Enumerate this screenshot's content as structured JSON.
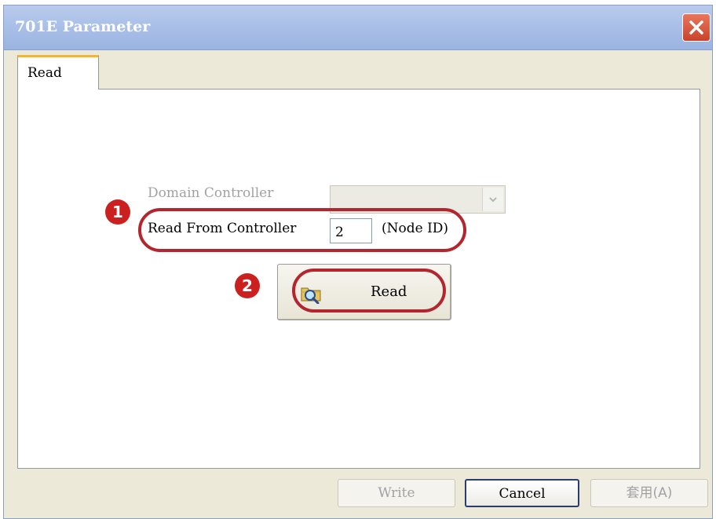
{
  "window": {
    "title": "701E Parameter"
  },
  "tabs": [
    {
      "label": "Read"
    }
  ],
  "form": {
    "domain_controller_label": "Domain Controller",
    "domain_controller_value": "",
    "read_from_label": "Read From Controller",
    "node_id_value": "2",
    "node_id_suffix": "(Node ID)",
    "read_button_label": "Read"
  },
  "annotations": {
    "step1": "1",
    "step2": "2"
  },
  "footer": {
    "write_label": "Write",
    "cancel_label": "Cancel",
    "apply_label": "套用(A)"
  },
  "colors": {
    "titlebar": "#aac0e8",
    "close_button": "#d9553a",
    "tab_highlight": "#f5b52e",
    "annotation_red": "#cc1f1f"
  },
  "icons": {
    "close": "close-icon",
    "dropdown": "chevron-down-icon",
    "read": "folder-magnifier-icon"
  }
}
